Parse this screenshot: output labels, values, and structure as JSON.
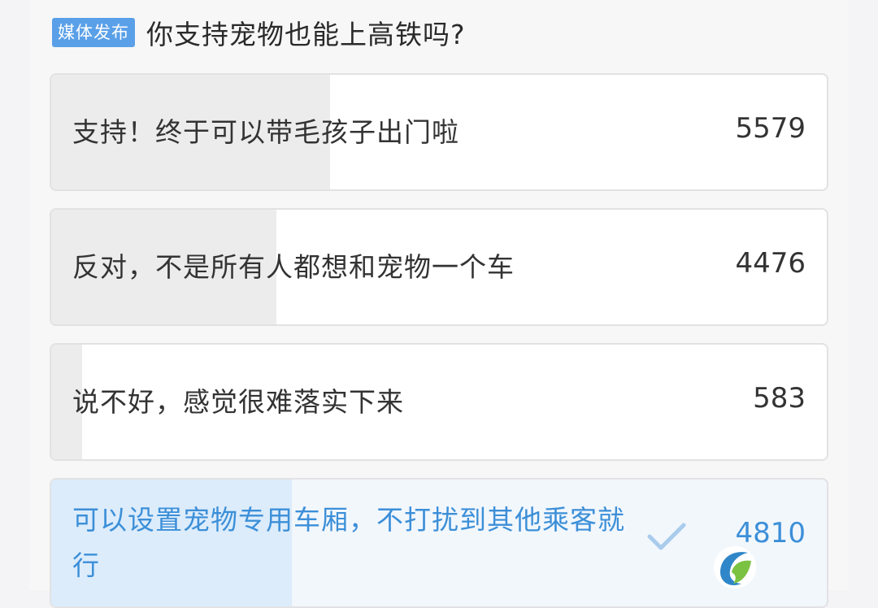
{
  "header": {
    "badge": "媒体发布",
    "title": "你支持宠物也能上高铁吗?"
  },
  "poll": {
    "options": [
      {
        "label": "支持！终于可以带毛孩子出门啦",
        "count": "5579",
        "share": 0.36
      },
      {
        "label": "反对，不是所有人都想和宠物一个车",
        "count": "4476",
        "share": 0.29
      },
      {
        "label": "说不好，感觉很难落实下来",
        "count": "583",
        "share": 0.04
      },
      {
        "label": "可以设置宠物专用车厢，不打扰到其他乘客就行",
        "count": "4810",
        "share": 0.31,
        "selected": true
      }
    ]
  },
  "icons": {
    "check": "check-icon",
    "watermark": "watermark-logo-icon"
  },
  "colors": {
    "badge": "#5aa0e8",
    "accent": "#3c8fd8",
    "selected_fill": "#dcecfb",
    "bar_fill": "#ececed"
  }
}
